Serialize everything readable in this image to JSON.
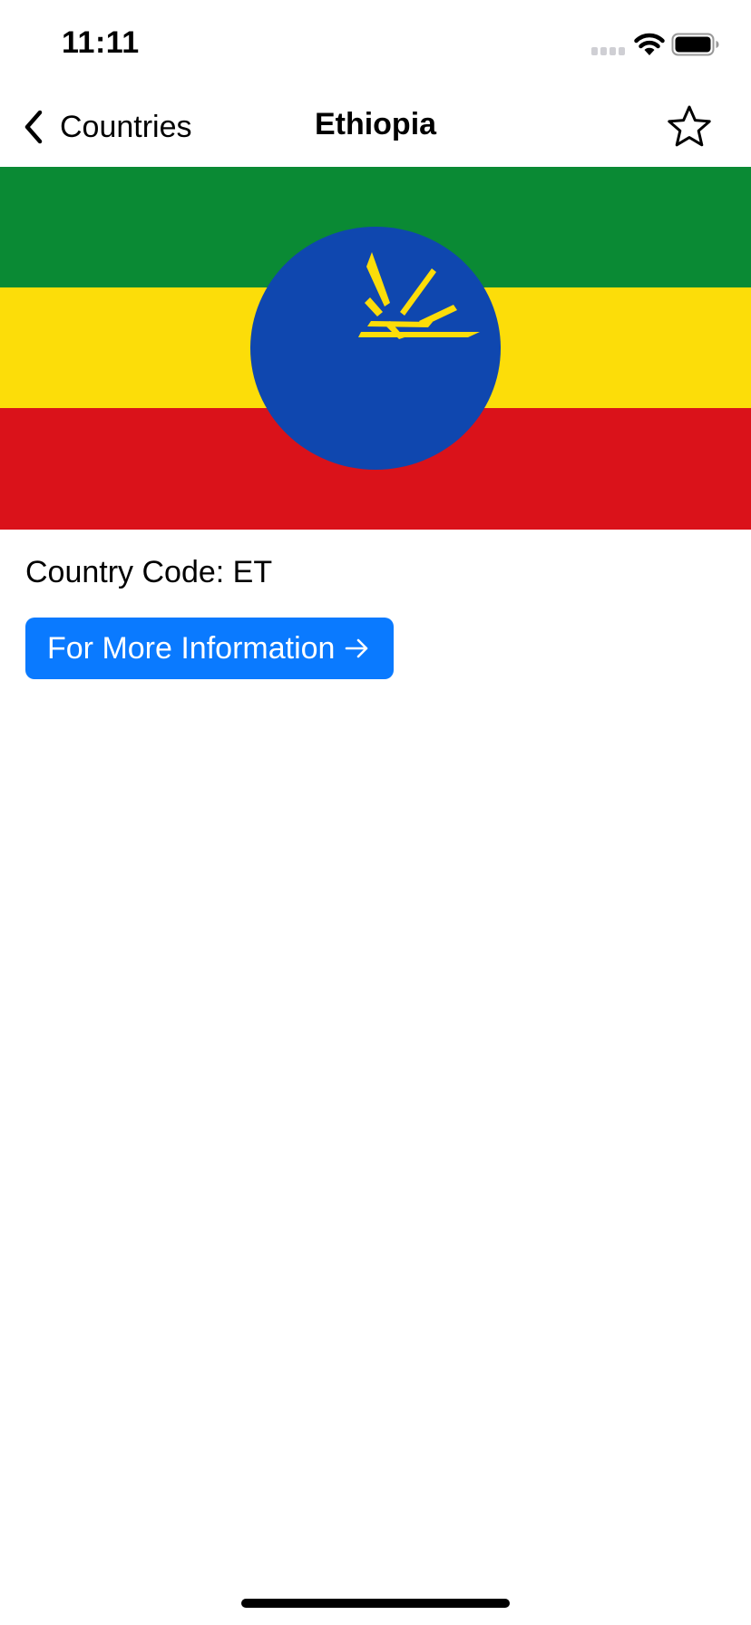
{
  "status_bar": {
    "time": "11:11",
    "icons": [
      "cellular-signal-icon",
      "wifi-icon",
      "battery-icon"
    ]
  },
  "nav": {
    "back_label": "Countries",
    "title": "Ethiopia",
    "favorite_icon": "star-outline-icon"
  },
  "flag": {
    "country": "Ethiopia",
    "stripe_colors": [
      "#0a8a34",
      "#fcdd09",
      "#da121a"
    ],
    "emblem_color": "#0f47af",
    "emblem_star_color": "#fcdd09"
  },
  "content": {
    "country_code_text": "Country Code: ET",
    "more_info_label": "For More Information",
    "more_info_icon": "arrow-right-icon"
  },
  "colors": {
    "accent": "#0a7aff",
    "background": "#ffffff"
  }
}
